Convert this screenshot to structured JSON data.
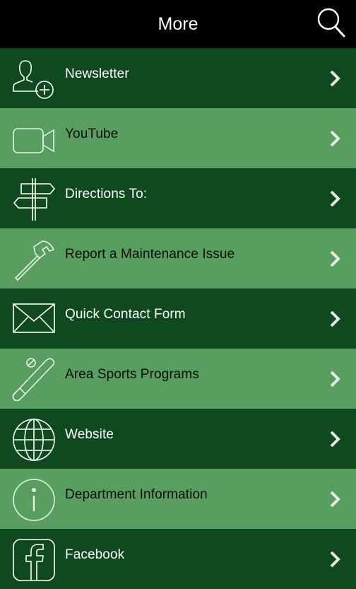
{
  "header": {
    "title": "More"
  },
  "items": [
    {
      "label": "Newsletter",
      "icon": "add-user-icon",
      "theme": "dark"
    },
    {
      "label": "YouTube",
      "icon": "video-camera-icon",
      "theme": "light"
    },
    {
      "label": "Directions To:",
      "icon": "signpost-icon",
      "theme": "dark"
    },
    {
      "label": "Report a Maintenance Issue",
      "icon": "hammer-icon",
      "theme": "light"
    },
    {
      "label": "Quick Contact Form",
      "icon": "envelope-icon",
      "theme": "dark"
    },
    {
      "label": "Area Sports Programs",
      "icon": "baseball-bat-icon",
      "theme": "light"
    },
    {
      "label": "Website",
      "icon": "globe-icon",
      "theme": "dark"
    },
    {
      "label": "Department Information",
      "icon": "info-icon",
      "theme": "light"
    },
    {
      "label": "Facebook",
      "icon": "facebook-icon",
      "theme": "dark"
    }
  ],
  "colors": {
    "dark_row": "#0f4a1f",
    "light_row": "#589e5e",
    "header": "#000000"
  }
}
